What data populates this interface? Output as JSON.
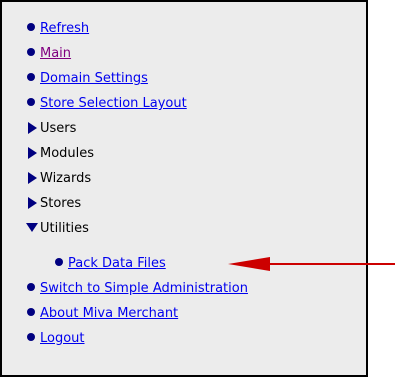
{
  "menu": {
    "items": [
      {
        "label": "Refresh",
        "type": "link",
        "marker": "dot"
      },
      {
        "label": "Main",
        "type": "visited",
        "marker": "dot"
      },
      {
        "label": "Domain Settings",
        "type": "link",
        "marker": "dot"
      },
      {
        "label": "Store Selection Layout",
        "type": "link",
        "marker": "dot"
      },
      {
        "label": "Users",
        "type": "text",
        "marker": "triangle-right"
      },
      {
        "label": "Modules",
        "type": "text",
        "marker": "triangle-right"
      },
      {
        "label": "Wizards",
        "type": "text",
        "marker": "triangle-right"
      },
      {
        "label": "Stores",
        "type": "text",
        "marker": "triangle-right"
      },
      {
        "label": "Utilities",
        "type": "text",
        "marker": "triangle-down"
      },
      {
        "label": "Pack Data Files",
        "type": "link",
        "marker": "dot",
        "sub": true
      },
      {
        "label": "Switch to Simple Administration",
        "type": "link",
        "marker": "dot"
      },
      {
        "label": "About Miva Merchant",
        "type": "link",
        "marker": "dot"
      },
      {
        "label": "Logout",
        "type": "link",
        "marker": "dot"
      }
    ]
  },
  "colors": {
    "panel_bg": "#ececec",
    "link": "#0000ee",
    "visited": "#800080",
    "text": "#000000",
    "bullet": "#000080",
    "callout_arrow": "#cc0000"
  },
  "icons": {
    "dot": "bullet-dot-icon",
    "triangle-right": "collapsed-triangle-icon",
    "triangle-down": "expanded-triangle-icon",
    "callout": "red-callout-arrow-icon"
  }
}
